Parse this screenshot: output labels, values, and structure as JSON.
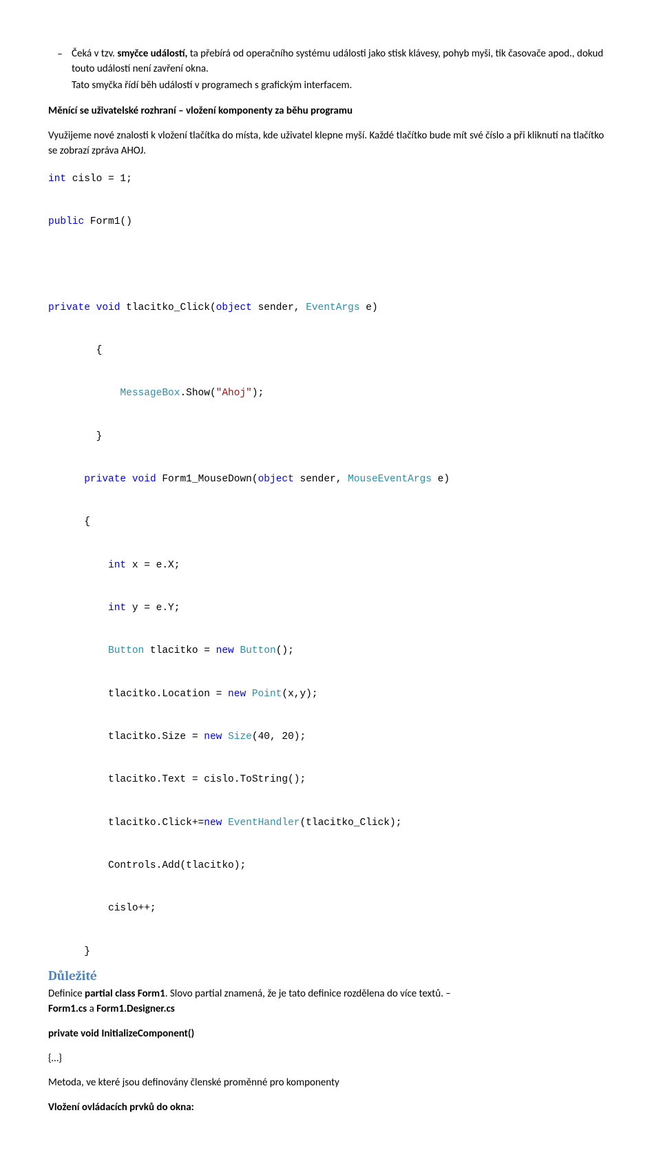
{
  "bullet": {
    "pre": "Čeká v tzv. ",
    "bold": "smyčce událostí,",
    "post": " ta přebírá od operačního systému události jako stisk klávesy, pohyb myši, tik časovače apod., dokud touto událostí není zavření okna."
  },
  "bullet_para2": "Tato smyčka řídí běh událostí v programech s grafickým interfacem.",
  "changing_heading": "Měnící se uživatelské rozhraní – vložení komponenty za běhu programu",
  "changing_para": "Využijeme nové znalosti k vložení tlačítka do místa, kde uživatel klepne myší. Každé tlačítko bude mít své číslo a při kliknutí na tlačítko se zobrazí zpráva AHOJ.",
  "code": {
    "l1_a": "int",
    "l1_b": " cislo = 1;",
    "l2_a": "public",
    "l2_b": " Form1()",
    "l3_a": "private",
    "l3_b": " ",
    "l3_c": "void",
    "l3_d": " tlacitko_Click(",
    "l3_e": "object",
    "l3_f": " sender, ",
    "l3_g": "EventArgs",
    "l3_h": " e)",
    "l4": "        {",
    "l5_a": "            ",
    "l5_b": "MessageBox",
    "l5_c": ".Show(",
    "l5_d": "\"Ahoj\"",
    "l5_e": ");",
    "l6": "        }",
    "l7_a": "      ",
    "l7_b": "private",
    "l7_c": " ",
    "l7_d": "void",
    "l7_e": " Form1_MouseDown(",
    "l7_f": "object",
    "l7_g": " sender, ",
    "l7_h": "MouseEventArgs",
    "l7_i": " e)",
    "l8": "      {",
    "l9_a": "          ",
    "l9_b": "int",
    "l9_c": " x = e.X;",
    "l10_a": "          ",
    "l10_b": "int",
    "l10_c": " y = e.Y;",
    "l11_a": "          ",
    "l11_b": "Button",
    "l11_c": " tlacitko = ",
    "l11_d": "new",
    "l11_e": " ",
    "l11_f": "Button",
    "l11_g": "();",
    "l12_a": "          tlacitko.Location = ",
    "l12_b": "new",
    "l12_c": " ",
    "l12_d": "Point",
    "l12_e": "(x,y);",
    "l13_a": "          tlacitko.Size = ",
    "l13_b": "new",
    "l13_c": " ",
    "l13_d": "Size",
    "l13_e": "(40, 20);",
    "l14": "          tlacitko.Text = cislo.ToString();",
    "l15_a": "          tlacitko.Click+=",
    "l15_b": "new",
    "l15_c": " ",
    "l15_d": "EventHandler",
    "l15_e": "(tlacitko_Click);",
    "l16": "          Controls.Add(tlacitko);",
    "l17": "          cislo++;",
    "l18": "      }"
  },
  "important_heading": "Důležité",
  "def_line": {
    "a": "Definice  ",
    "b": "partial class Form1",
    "c": ". Slovo partial znamená, že je tato definice rozdělena do více textů. – ",
    "d": "Form1.cs",
    "e": " a ",
    "f": "Form1.Designer.cs"
  },
  "init_component": "private void InitializeComponent()",
  "braces": "{…}",
  "metoda_text": "Metoda, ve které jsou definovány členské proměnné pro komponenty",
  "vlozeni_heading": "Vložení ovládacích prvků do okna:"
}
